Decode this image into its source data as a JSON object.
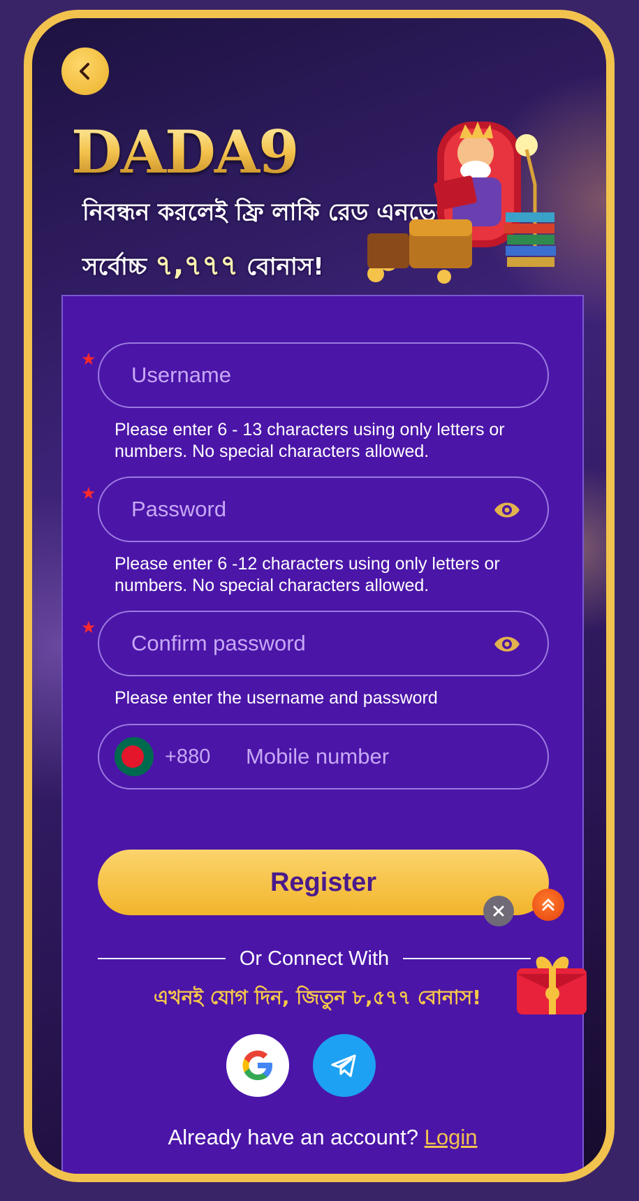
{
  "header": {
    "logo_text": "DADA9",
    "promo_line1": "নিবন্ধন করলেই ফ্রি লাকি রেড এনভেলপ",
    "promo_line2_prefix": "সর্বোচ্চ",
    "promo_line2_amount": "৭,৭৭৭",
    "promo_line2_suffix": "বোনাস!"
  },
  "form": {
    "username_placeholder": "Username",
    "username_hint": "Please enter 6 - 13 characters using only letters or numbers. No special characters allowed.",
    "password_placeholder": "Password",
    "password_hint": "Please enter 6 -12 characters using only letters or numbers. No special characters allowed.",
    "confirm_placeholder": "Confirm password",
    "confirm_hint": "Please enter the username and password",
    "country_code": "+880",
    "mobile_placeholder": "Mobile number",
    "required_mark": "★",
    "register_label": "Register"
  },
  "social": {
    "connect_label": "Or Connect With",
    "bonus_text": "এখনই যোগ দিন, জিতুন ৮,৫৭৭ বোনাস!",
    "login_prompt": "Already have an account?",
    "login_link": "Login"
  },
  "colors": {
    "accent_gold": "#f2c24e",
    "form_bg": "#4b15a8",
    "placeholder": "#c7a8f5"
  },
  "icons": [
    "back-chevron-icon",
    "eye-icon",
    "bangladesh-flag-icon",
    "close-icon",
    "scroll-up-icon",
    "gift-box-icon",
    "google-icon",
    "telegram-icon"
  ]
}
